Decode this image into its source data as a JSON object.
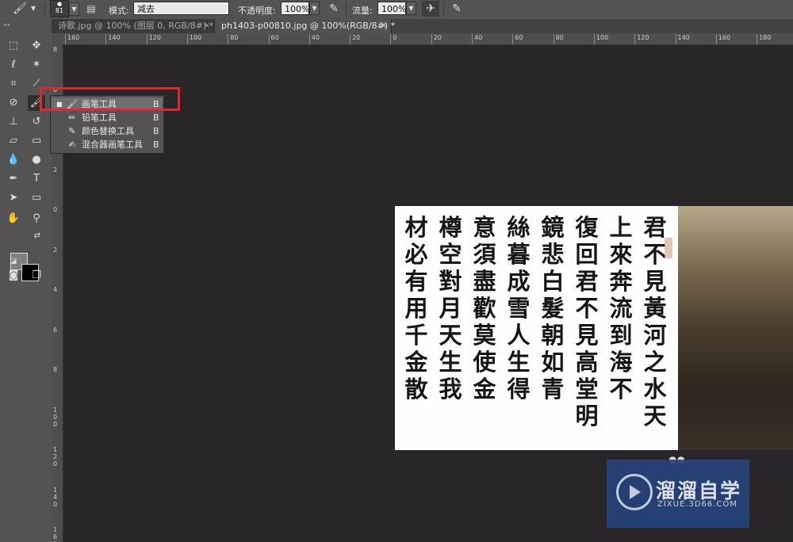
{
  "options_bar": {
    "brush_size": "81",
    "mode_label": "模式:",
    "mode_value": "减去",
    "opacity_label": "不透明度:",
    "opacity_value": "100%",
    "flow_label": "流量:",
    "flow_value": "100%"
  },
  "tabs": [
    {
      "label": "诗歌.jpg @ 100% (图层 0, RGB/8#) *",
      "close": "×"
    },
    {
      "label": "ph1403-p00810.jpg @ 100%(RGB/8#) *",
      "close": "×"
    }
  ],
  "ruler": {
    "h_ticks": [
      "160",
      "140",
      "120",
      "100",
      "80",
      "60",
      "40",
      "20",
      "0",
      "20",
      "40",
      "60",
      "80",
      "100",
      "120",
      "140",
      "160",
      "180"
    ],
    "v_ticks": [
      "8",
      "6",
      "4",
      "2",
      "0",
      "2",
      "4",
      "6",
      "8",
      "100",
      "120",
      "140",
      "160"
    ]
  },
  "brush_flyout": {
    "items": [
      {
        "icon": "paintbrush-icon",
        "label": "画笔工具",
        "key": "B",
        "active": true
      },
      {
        "icon": "pencil-icon",
        "label": "铅笔工具",
        "key": "B",
        "active": false
      },
      {
        "icon": "color-replacement-icon",
        "label": "颜色替换工具",
        "key": "B",
        "active": false
      },
      {
        "icon": "mixer-brush-icon",
        "label": "混合器画笔工具",
        "key": "B",
        "active": false
      }
    ]
  },
  "colors": {
    "foreground": "#808080",
    "background": "#000000",
    "highlight": "#e4252c"
  },
  "document": {
    "columns": [
      "君不見黃河之水天",
      "上來奔流到海不",
      "復回君不見高堂明",
      "鏡悲白髮朝如青",
      "絲暮成雪人生得",
      "意須盡歡莫使金",
      "樽空對月天生我",
      "材必有用千金散"
    ]
  },
  "watermark": {
    "title": "溜溜自学",
    "subtitle": "ZIXUE.3D66.COM"
  }
}
